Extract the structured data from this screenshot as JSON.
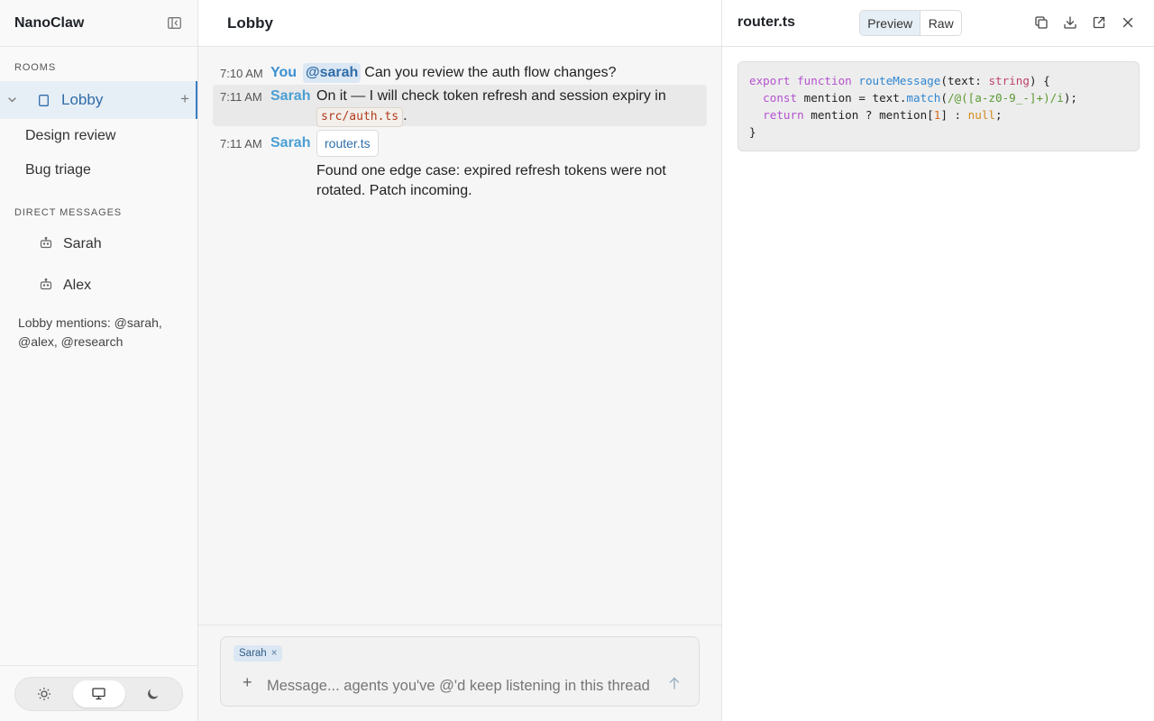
{
  "sidebar": {
    "brand": "NanoClaw",
    "rooms_label": "ROOMS",
    "active_room": "Lobby",
    "rooms": [
      "Design review",
      "Bug triage"
    ],
    "dm_label": "DIRECT MESSAGES",
    "dms": [
      "Sarah",
      "Alex"
    ],
    "mentions_note": "Lobby mentions: @sarah, @alex, @research",
    "theme_options": [
      "light",
      "system",
      "dark"
    ],
    "theme_selected": "system"
  },
  "main": {
    "title": "Lobby",
    "messages": [
      {
        "time": "7:10 AM",
        "author": "You",
        "mention": "@sarah",
        "text": "Can you review the auth flow changes?"
      },
      {
        "time": "7:11 AM",
        "author": "Sarah",
        "text": "On it — I will check token refresh and session expiry in",
        "code": "src/auth.ts",
        "suffix": "."
      },
      {
        "time": "7:11 AM",
        "author": "Sarah",
        "attachment": "router.ts",
        "text": "Found one edge case: expired refresh tokens were not rotated. Patch incoming."
      }
    ],
    "composer": {
      "target_chip": "Sarah",
      "target_chip_close": "×",
      "placeholder": "Message... agents you've @'d keep listening in this thread",
      "value": ""
    }
  },
  "panel": {
    "filename": "router.ts",
    "view_options": [
      "Preview",
      "Raw"
    ],
    "view_selected": "Preview",
    "code_lines": [
      "export function routeMessage(text: string) {",
      "  const mention = text.match(/@([a-z0-9_-]+)/i);",
      "  return mention ? mention[1] : null;",
      "}"
    ]
  },
  "colors": {
    "accent": "#3a7cc4",
    "author": "#4a9fd4",
    "active_room_bg": "#e6eef6"
  }
}
